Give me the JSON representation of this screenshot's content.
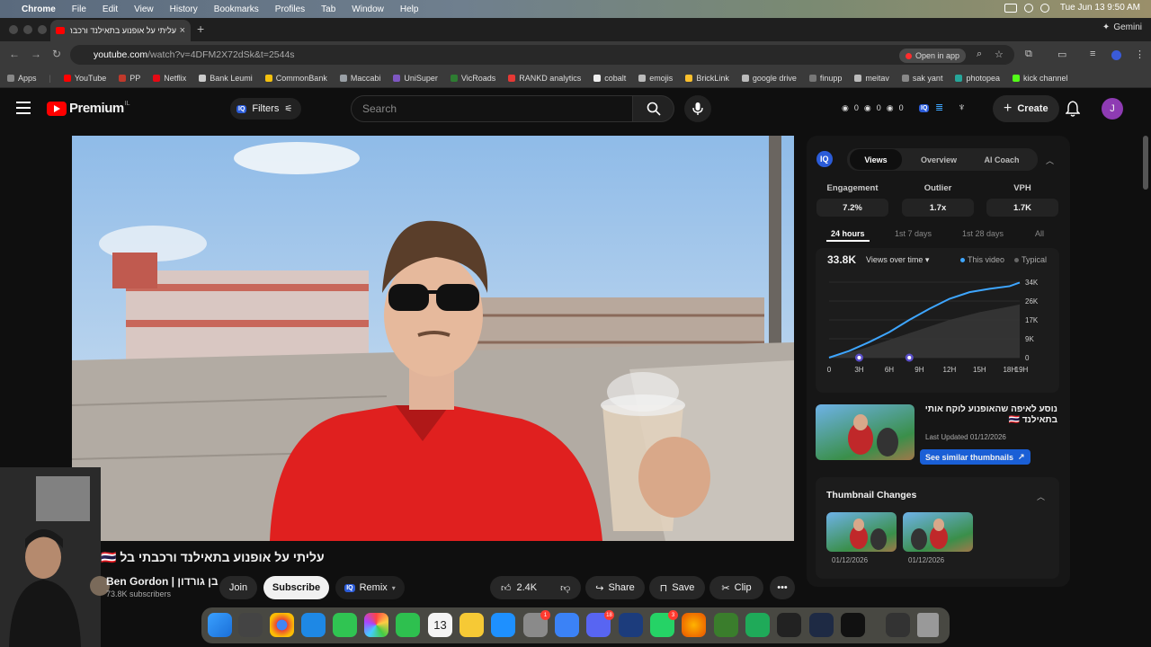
{
  "menubar": {
    "app": "Chrome",
    "items": [
      "File",
      "Edit",
      "View",
      "History",
      "Bookmarks",
      "Profiles",
      "Tab",
      "Window",
      "Help"
    ],
    "clock": "Tue Jun 13  9:50 AM"
  },
  "browser": {
    "tab_title": "עליתי על אופנוע בתאילנד ורכבתי",
    "gemini_label": "Gemini",
    "url_domain": "youtube.com",
    "url_path": "/watch?v=4DFM2X72dSk&t=2544s",
    "open_in_app": "Open in app"
  },
  "bookmarks": [
    {
      "label": "Apps",
      "color": "#888888"
    },
    {
      "label": "YouTube",
      "color": "#ff0000"
    },
    {
      "label": "PP",
      "color": "#c0392b"
    },
    {
      "label": "Netflix",
      "color": "#e50914"
    },
    {
      "label": "Bank Leumi",
      "color": "#cccccc"
    },
    {
      "label": "CommonBank",
      "color": "#f4c10f"
    },
    {
      "label": "Maccabi",
      "color": "#9aa0a6"
    },
    {
      "label": "UniSuper",
      "color": "#7e57c2"
    },
    {
      "label": "VicRoads",
      "color": "#2e7d32"
    },
    {
      "label": "RANKD analytics",
      "color": "#e53935"
    },
    {
      "label": "cobalt",
      "color": "#eeeeee"
    },
    {
      "label": "emojis",
      "color": "#bbbbbb"
    },
    {
      "label": "BrickLink",
      "color": "#fbc02d"
    },
    {
      "label": "google drive",
      "color": "#bbbbbb"
    },
    {
      "label": "finupp",
      "color": "#777777"
    },
    {
      "label": "meitav",
      "color": "#bbbbbb"
    },
    {
      "label": "sak yant",
      "color": "#888888"
    },
    {
      "label": "photopea",
      "color": "#26a69a"
    },
    {
      "label": "kick channel",
      "color": "#53fc18"
    }
  ],
  "youtube": {
    "logo_text": "Premium",
    "logo_country": "IL",
    "filters_label": "Filters",
    "search_placeholder": "Search",
    "stats": [
      "0",
      "0",
      "0"
    ],
    "create_label": "Create",
    "avatar_letter": "J"
  },
  "video": {
    "title": "עליתי על אופנוע בתאילנד ורכבתי בל 🇹🇭",
    "channel_name": "Ben Gordon | בן גורדון",
    "subscribers": "73.8K subscribers",
    "join_label": "Join",
    "subscribe_label": "Subscribe",
    "remix_label": "Remix",
    "likes": "2.4K",
    "share_label": "Share",
    "save_label": "Save",
    "clip_label": "Clip"
  },
  "panel": {
    "badge": "IQ",
    "tabs": [
      "Views",
      "Overview",
      "AI Coach"
    ],
    "metrics": [
      {
        "label": "Engagement",
        "value": "7.2%"
      },
      {
        "label": "Outlier",
        "value": "1.7x"
      },
      {
        "label": "VPH",
        "value": "1.7K"
      }
    ],
    "ranges": [
      "24 hours",
      "1st 7 days",
      "1st 28 days",
      "All"
    ],
    "total_views": "33.8K",
    "views_dropdown": "Views over time",
    "legend_this": "This video",
    "legend_typical": "Typical",
    "similar": {
      "title": "נוסע לאיפה שהאופנוע לוקח אותי בתאילנד 🇹🇭",
      "updated": "Last Updated 01/12/2026",
      "button": "See similar thumbnails"
    },
    "thumbnail_changes": {
      "title": "Thumbnail Changes",
      "dates": [
        "01/12/2026",
        "01/12/2026"
      ]
    }
  },
  "chart_data": {
    "type": "line",
    "x_labels": [
      "0",
      "3H",
      "6H",
      "9H",
      "12H",
      "15H",
      "18H",
      "19H"
    ],
    "y_labels": [
      "34K",
      "26K",
      "17K",
      "9K",
      "0"
    ],
    "ylim": [
      0,
      34000
    ],
    "series": [
      {
        "name": "This video",
        "color": "#3ea6ff",
        "points": [
          [
            0,
            0
          ],
          [
            2,
            3000
          ],
          [
            4,
            7000
          ],
          [
            6,
            11500
          ],
          [
            8,
            17000
          ],
          [
            10,
            22000
          ],
          [
            12,
            26500
          ],
          [
            14,
            29500
          ],
          [
            16,
            31000
          ],
          [
            18,
            32200
          ],
          [
            19,
            33800
          ]
        ]
      },
      {
        "name": "Typical",
        "color": "#555555",
        "points": [
          [
            0,
            0
          ],
          [
            3,
            3500
          ],
          [
            6,
            8000
          ],
          [
            9,
            12500
          ],
          [
            12,
            17000
          ],
          [
            15,
            20500
          ],
          [
            18,
            23000
          ],
          [
            19,
            24000
          ]
        ]
      }
    ],
    "markers_x": [
      3,
      8
    ],
    "grid": true
  },
  "colors": {
    "yt_red": "#ff0000",
    "iq_blue": "#2b5cd9",
    "series_blue": "#3ea6ff"
  }
}
